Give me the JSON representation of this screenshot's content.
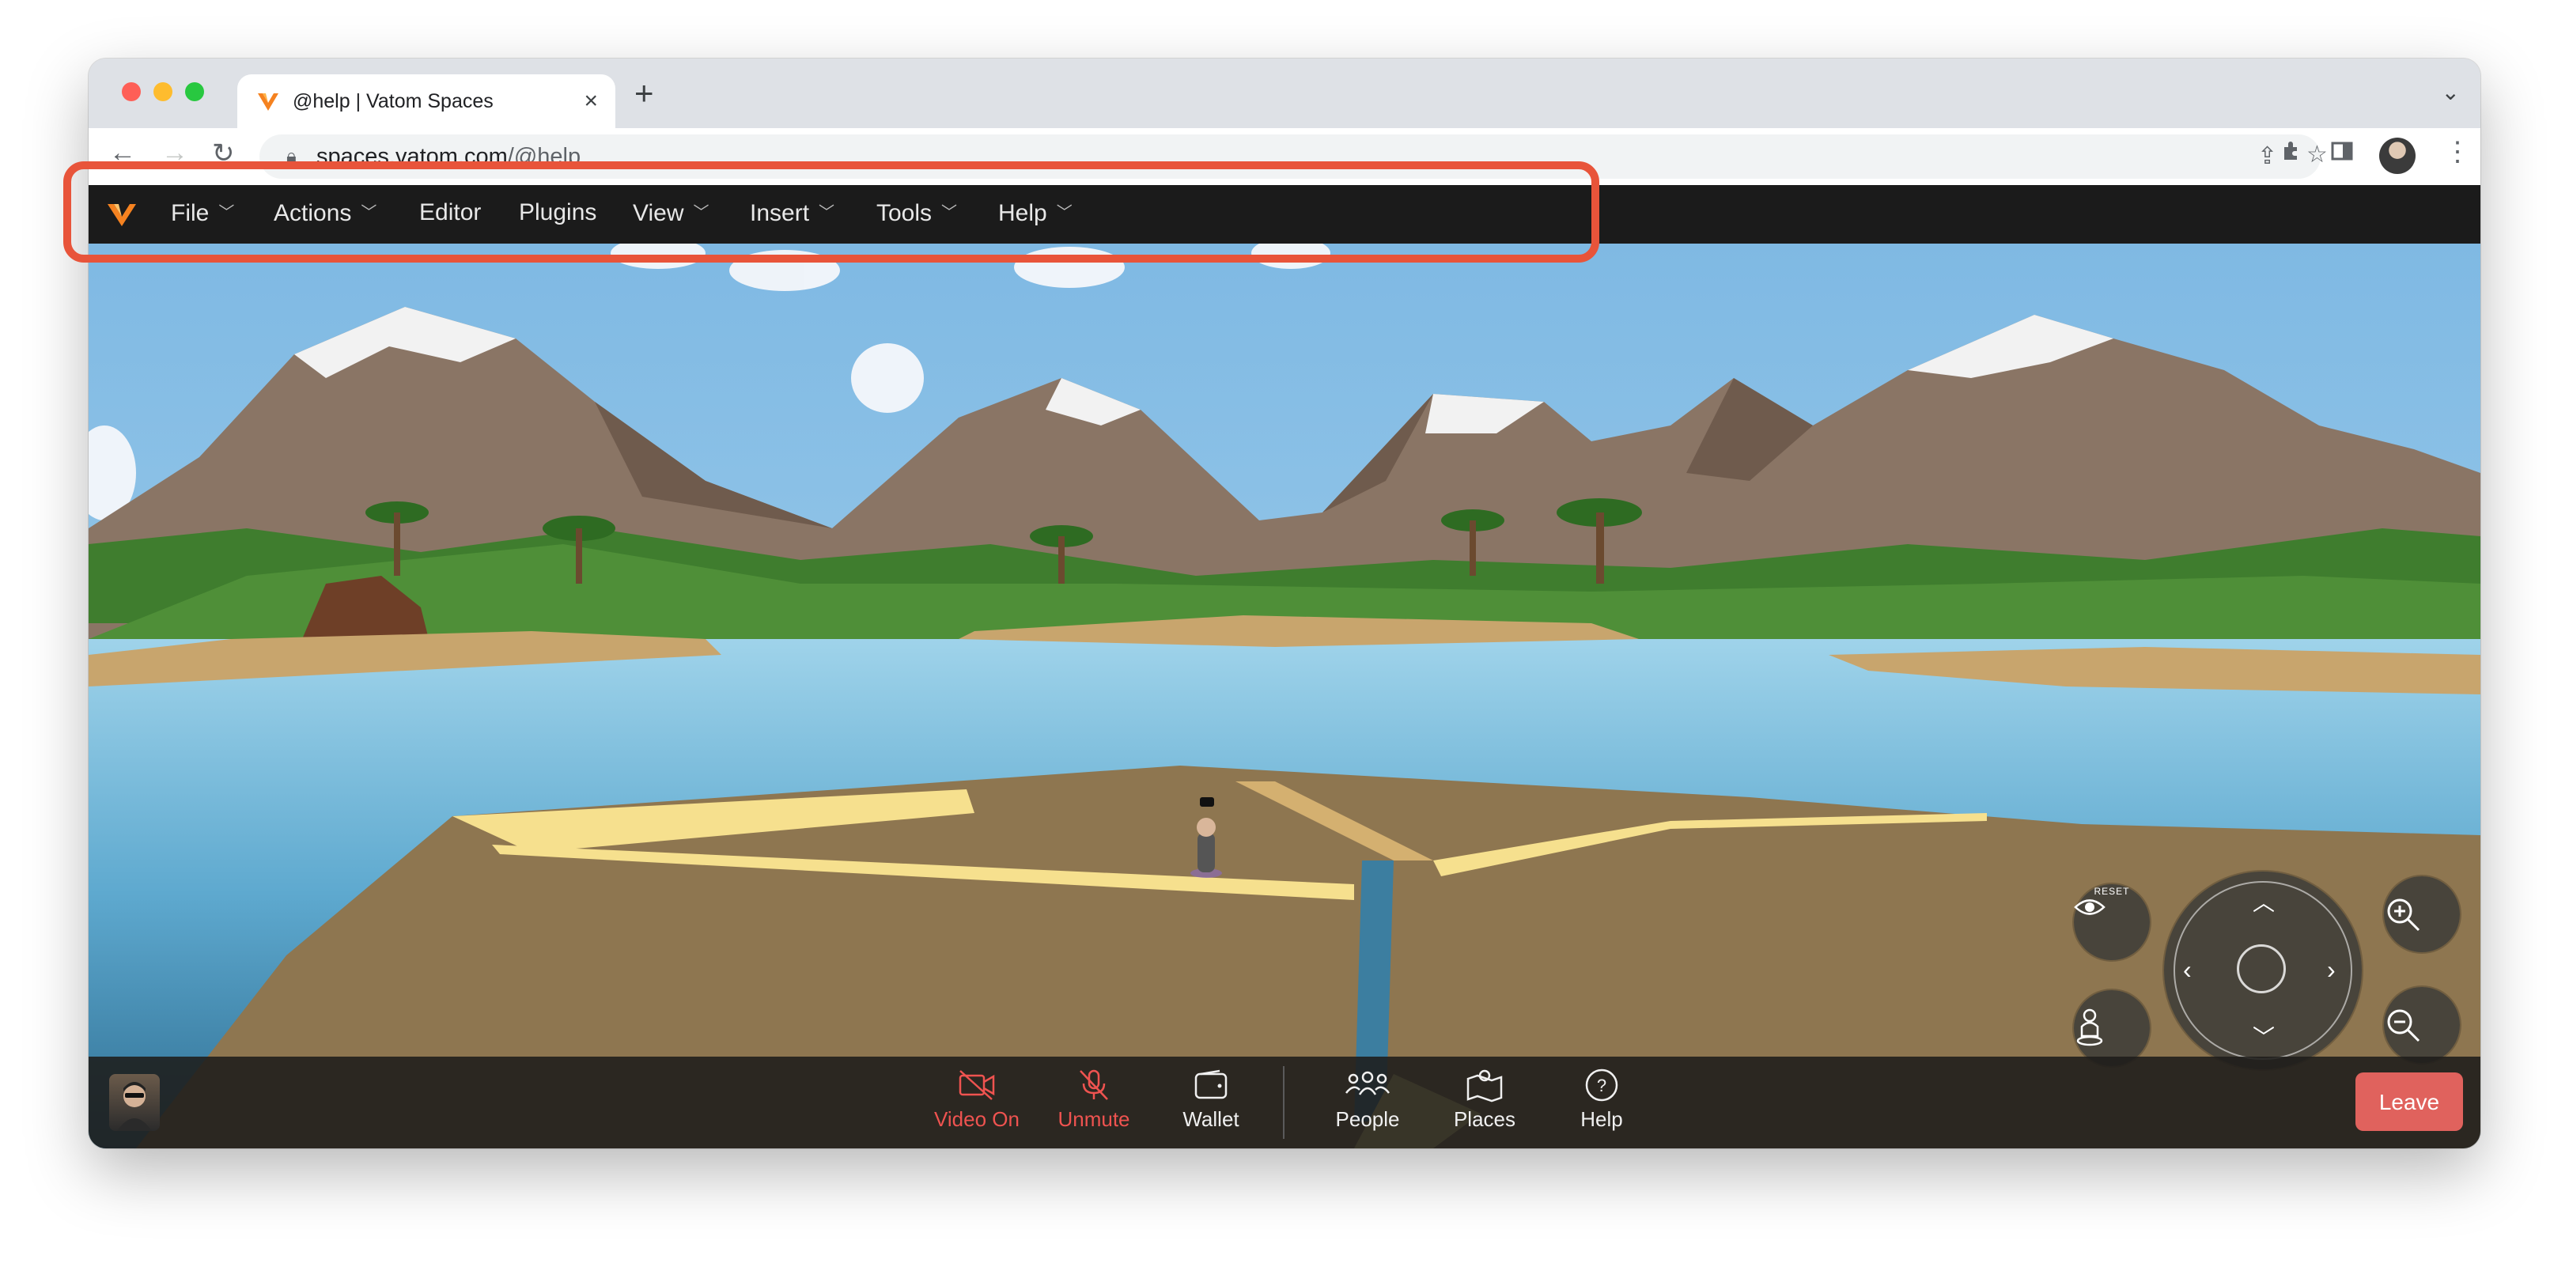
{
  "browser": {
    "tab_title": "@help | Vatom Spaces",
    "tab_close": "×",
    "new_tab": "+",
    "url_host": "spaces.vatom.com",
    "url_path": "/@help"
  },
  "menubar": {
    "items": [
      {
        "label": "File",
        "has_dropdown": true
      },
      {
        "label": "Actions",
        "has_dropdown": true
      },
      {
        "label": "Editor",
        "has_dropdown": false
      },
      {
        "label": "Plugins",
        "has_dropdown": false
      },
      {
        "label": "View",
        "has_dropdown": true
      },
      {
        "label": "Insert",
        "has_dropdown": true
      },
      {
        "label": "Tools",
        "has_dropdown": true
      },
      {
        "label": "Help",
        "has_dropdown": true
      }
    ]
  },
  "scene_controls": {
    "reset_label": "RESET"
  },
  "bottombar": {
    "video_label": "Video On",
    "mute_label": "Unmute",
    "wallet_label": "Wallet",
    "people_label": "People",
    "places_label": "Places",
    "help_label": "Help",
    "leave_label": "Leave"
  },
  "colors": {
    "accent": "#f58220",
    "media_off": "#ef5350",
    "leave_button": "#e0625d",
    "highlight": "#e8543a"
  }
}
